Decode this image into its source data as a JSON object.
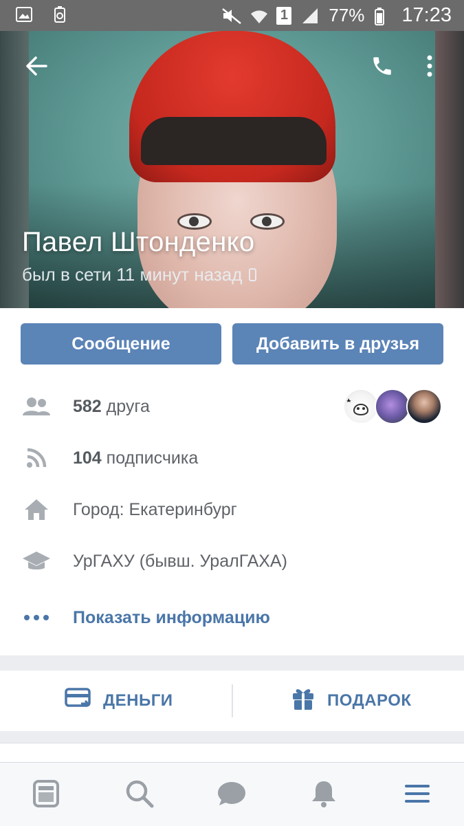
{
  "status_bar": {
    "battery_percent": "77%",
    "time": "17:23",
    "sim_slot": "1",
    "icons": [
      "gallery-icon",
      "recycle-icon",
      "mute-icon",
      "wifi-icon",
      "signal-icon",
      "battery-icon"
    ]
  },
  "profile": {
    "name": "Павел Штонденко",
    "status": "был в сети 11 минут назад",
    "device": "phone-icon"
  },
  "actions": {
    "message": "Сообщение",
    "add_friend": "Добавить в друзья"
  },
  "info": {
    "friends_count": "582",
    "friends_label": " друга",
    "followers_count": "104",
    "followers_label": " подписчика",
    "city": "Город: Екатеринбург",
    "education": "УрГАХУ (бывш. УралГАХА)",
    "show_info": "Показать информацию"
  },
  "money_gift": {
    "money": "ДЕНЬГИ",
    "gift": "ПОДАРОК"
  },
  "colors": {
    "accent": "#4a76a8",
    "button": "#5b84b7",
    "text_secondary": "#5f6368",
    "icon_gray": "#9aa0a6"
  },
  "tabs": [
    "news-icon",
    "search-icon",
    "messages-icon",
    "notifications-icon",
    "menu-icon"
  ]
}
